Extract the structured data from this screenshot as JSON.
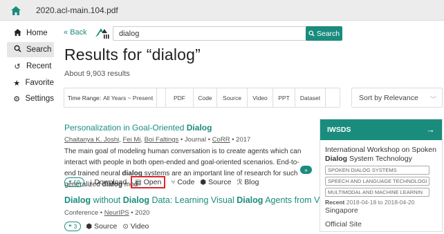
{
  "topbar": {
    "title": "2020.acl-main.104.pdf",
    "home_icon": "home-icon",
    "accent": "#1a8c7e"
  },
  "sidebar": {
    "items": [
      {
        "label": "Home",
        "icon": "home-icon",
        "active": false
      },
      {
        "label": "Search",
        "icon": "search-icon",
        "active": true
      },
      {
        "label": "Recent",
        "icon": "history-icon",
        "active": false
      },
      {
        "label": "Favorite",
        "icon": "star-icon",
        "active": false
      },
      {
        "label": "Settings",
        "icon": "gear-icon",
        "active": false
      }
    ]
  },
  "search": {
    "back_label": "Back",
    "query": "dialog",
    "button_label": "Search"
  },
  "results": {
    "title": "Results for “dialog”",
    "count_text": "About 9,903 results"
  },
  "filters": {
    "time_range_key": "Time Range:",
    "time_range_value": "All Years ~ Present",
    "types": [
      "PDF",
      "Code",
      "Source",
      "Video",
      "PPT",
      "Dataset"
    ],
    "sort": "Sort by Relevance"
  },
  "result1": {
    "title_pre": "Personalization in Goal-Oriented ",
    "title_bold": "Dialog",
    "authors": [
      "Chaitanya K. Joshi",
      "Fei Mi",
      "Boi Faltings"
    ],
    "venue_type": "Journal",
    "venue": "CoRR",
    "year": "2017",
    "abstract_a": "The main goal of modeling human conversation is to create agents which can interact with people in both open-ended and goal-oriented scenarios. End-to-end trained neural ",
    "abstract_b1": "dialog",
    "abstract_c": " systems are an important line of research for such generalized ",
    "abstract_b2": "dialog",
    "abstract_d": " mod",
    "citations": "59",
    "actions": [
      "Download",
      "Open",
      "Code",
      "Source",
      "Blog"
    ]
  },
  "result2": {
    "title_b1": "Dialog",
    "title_m1": " without ",
    "title_b2": "Dialog",
    "title_m2": " Data: Learning Visual ",
    "title_b3": "Dialog",
    "title_m3": " Agents from VQA Data",
    "venue_type": "Conference",
    "venue": "NeurIPS",
    "year": "2020",
    "citations": "3",
    "actions": [
      "Source",
      "Video"
    ]
  },
  "card": {
    "header": "IWSDS",
    "desc_a": "International Workshop on Spoken ",
    "desc_b": "Dialog",
    "desc_c": " System Technology",
    "tags": [
      "SPOKEN DIALOG SYSTEMS",
      "SPEECH AND LANGUAGE TECHNOLOGI",
      "MULTIMODAL AND MACHINE LEARNIN"
    ],
    "recent_label": "Recent",
    "recent_dates": "2018-04-18 to 2018-04-20",
    "location": "Singapore",
    "link": "Official Site"
  }
}
